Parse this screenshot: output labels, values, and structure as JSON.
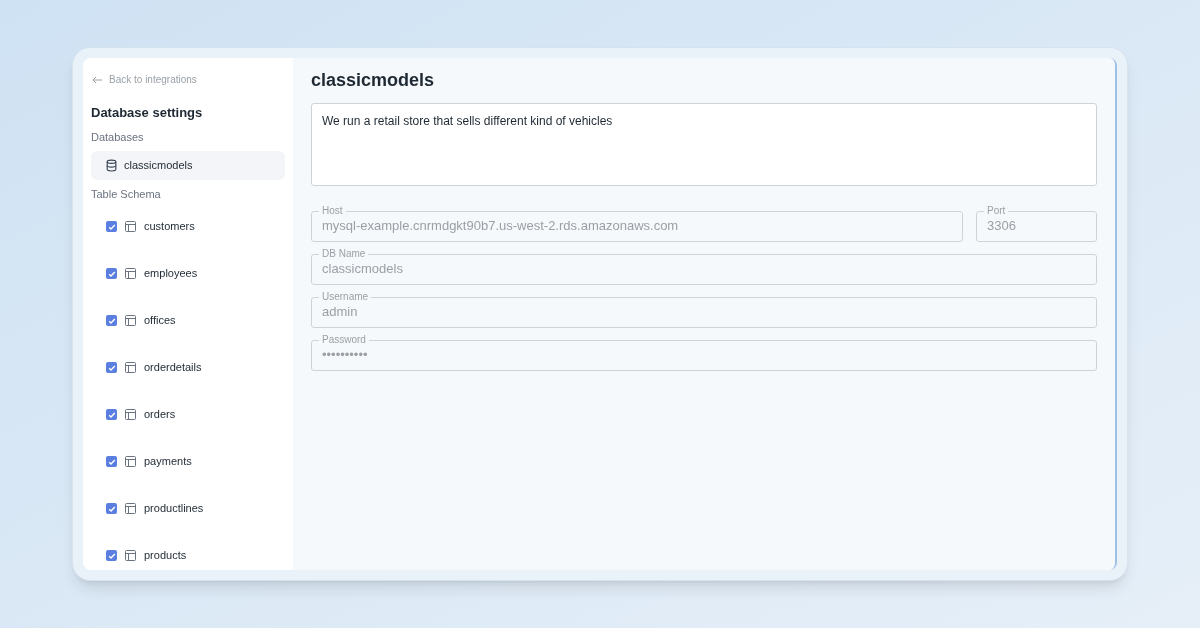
{
  "sidebar": {
    "back_link": "Back to integrations",
    "title": "Database settings",
    "databases_label": "Databases",
    "databases": [
      {
        "name": "classicmodels",
        "selected": true
      }
    ],
    "schema_label": "Table Schema",
    "tables": [
      {
        "name": "customers",
        "checked": true
      },
      {
        "name": "employees",
        "checked": true
      },
      {
        "name": "offices",
        "checked": true
      },
      {
        "name": "orderdetails",
        "checked": true
      },
      {
        "name": "orders",
        "checked": true
      },
      {
        "name": "payments",
        "checked": true
      },
      {
        "name": "productlines",
        "checked": true
      },
      {
        "name": "products",
        "checked": true
      }
    ]
  },
  "main": {
    "title": "classicmodels",
    "description": "We run a retail store that sells different kind of vehicles",
    "fields": [
      {
        "label": "Host",
        "value": "mysql-example.cnrmdgkt90b7.us-west-2.rds.amazonaws.com"
      },
      {
        "label": "Port",
        "value": "3306"
      },
      {
        "label": "DB Name",
        "value": "classicmodels"
      },
      {
        "label": "Username",
        "value": "admin"
      },
      {
        "label": "Password",
        "value": "••••••••••"
      }
    ]
  }
}
